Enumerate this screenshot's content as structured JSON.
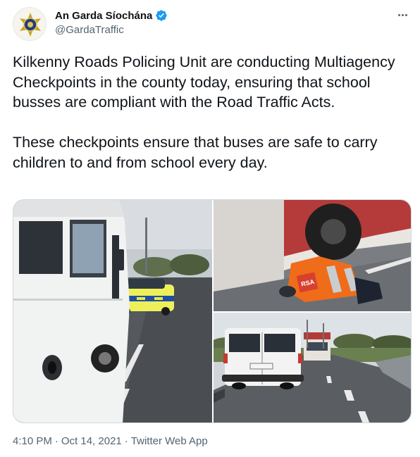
{
  "author": {
    "display_name": "An Garda Síochána",
    "handle": "@GardaTraffic",
    "verified": true,
    "avatar_icon": "garda-crest-icon"
  },
  "menu_icon": "more-options-icon",
  "tweet": {
    "text": "Kilkenny Roads Policing Unit are conducting Multiagency Checkpoints in the county today, ensuring that school busses are compliant with the Road Traffic Acts.\n\nThese checkpoints ensure that buses are safe to carry children to and from school every day."
  },
  "photos": [
    {
      "id": "photo-white-bus-garda-car"
    },
    {
      "id": "photo-rsa-inspector-under-bus"
    },
    {
      "id": "photo-white-van-roadside"
    }
  ],
  "meta": {
    "time": "4:10 PM",
    "separator": "·",
    "date": "Oct 14, 2021",
    "app": "Twitter Web App"
  },
  "colors": {
    "text": "#0f1419",
    "secondary": "#536471",
    "verified": "#1d9bf0"
  }
}
